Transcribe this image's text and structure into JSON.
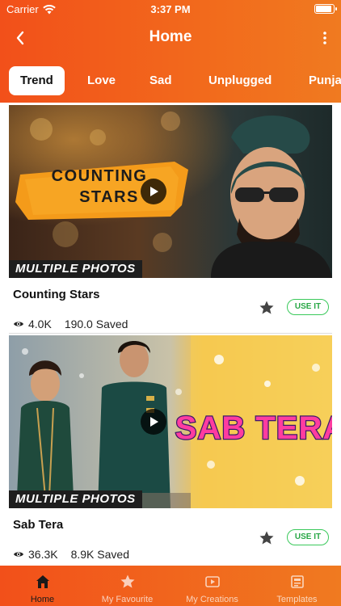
{
  "status_bar": {
    "carrier": "Carrier",
    "time": "3:37 PM"
  },
  "navbar": {
    "title": "Home",
    "back_icon": "chevron-left-icon",
    "more_icon": "more-vertical-icon"
  },
  "tabs": [
    {
      "label": "Trend",
      "active": true
    },
    {
      "label": "Love",
      "active": false
    },
    {
      "label": "Sad",
      "active": false
    },
    {
      "label": "Unplugged",
      "active": false
    },
    {
      "label": "Punja",
      "active": false
    }
  ],
  "cards": [
    {
      "title": "Counting Stars",
      "thumbnail_text": "COUNTING STARS",
      "ribbon": "MULTIPLE PHOTOS",
      "views": "4.0K",
      "saved": "190.0 Saved",
      "button": "USE IT"
    },
    {
      "title": "Sab Tera",
      "thumbnail_text": "SAB TERA",
      "ribbon": "MULTIPLE PHOTOS",
      "views": "36.3K",
      "saved": "8.9K Saved",
      "button": "USE IT"
    }
  ],
  "tabbar": [
    {
      "label": "Home",
      "icon": "home-icon",
      "active": true
    },
    {
      "label": "My Favourite",
      "icon": "star-icon",
      "active": false
    },
    {
      "label": "My Creations",
      "icon": "video-icon",
      "active": false
    },
    {
      "label": "Templates",
      "icon": "templates-icon",
      "active": false
    }
  ],
  "colors": {
    "accent": "#f2501a",
    "use_it_green": "#28a745"
  }
}
